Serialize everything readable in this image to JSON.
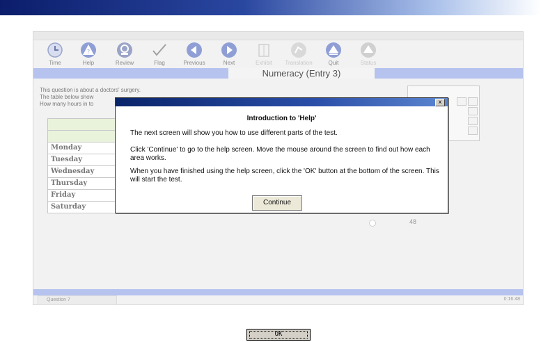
{
  "toolbar": {
    "items": [
      {
        "label": "Time",
        "icon": "clock-icon"
      },
      {
        "label": "Help",
        "icon": "help-icon"
      },
      {
        "label": "Review",
        "icon": "review-icon"
      },
      {
        "label": "Flag",
        "icon": "checkmark-flag-icon"
      },
      {
        "label": "Previous",
        "icon": "arrow-left-icon"
      },
      {
        "label": "Next",
        "icon": "arrow-right-icon"
      },
      {
        "label": "Exhibit",
        "icon": "exhibit-icon"
      },
      {
        "label": "Translation",
        "icon": "translation-icon"
      },
      {
        "label": "Quit",
        "icon": "quit-icon"
      },
      {
        "label": "Status",
        "icon": "status-icon"
      }
    ]
  },
  "page": {
    "title": "Numeracy (Entry 3)"
  },
  "question": {
    "line1": "This question is about a doctors' surgery.",
    "line2": "The table below show",
    "line3": "How many hours in to"
  },
  "table": {
    "days": [
      "Monday",
      "Tuesday",
      "Wednesday",
      "Thursday",
      "Friday",
      "Saturday"
    ]
  },
  "answer": {
    "option_value": "48"
  },
  "status_bar": {
    "question_label": "Question 7",
    "timer": "0:16:48"
  },
  "dialog": {
    "close_glyph": "x",
    "heading": "Introduction to 'Help'",
    "para1": "The next screen will show you how to use different parts of the test.",
    "para2": "Click 'Continue' to go to the help screen. Move the mouse around the screen to find out how each area works.",
    "para3": "When you have finished using the help screen, click the 'OK' button at the bottom of the screen. This will start the test.",
    "continue_label": "Continue"
  },
  "ok_button": {
    "label": "OK"
  },
  "colors": {
    "accent_band": "#b6c3ef",
    "dialog_title": "#0a246a",
    "table_header": "#e9f3dc"
  }
}
